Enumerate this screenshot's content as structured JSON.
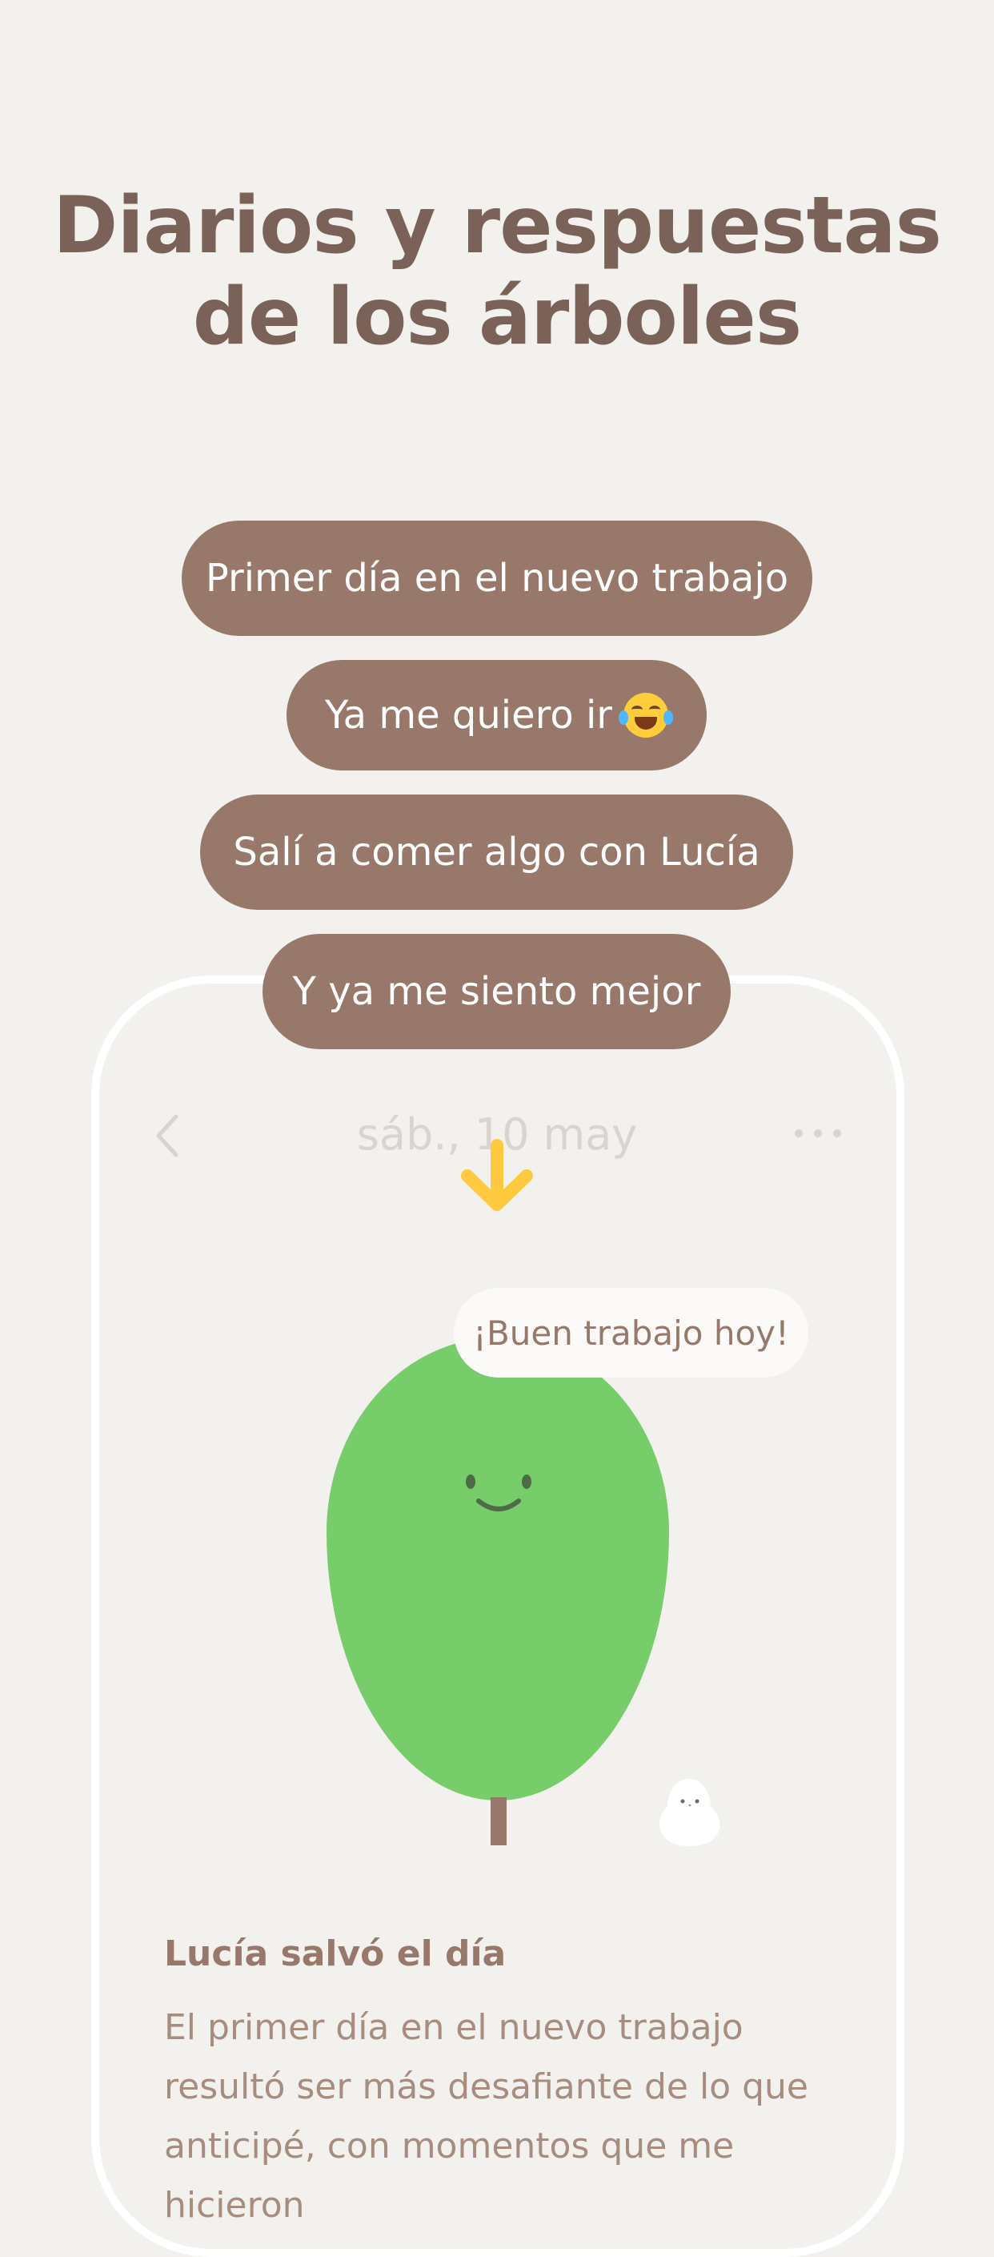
{
  "headline": {
    "line1": "Diarios y respuestas",
    "line2": "de los árboles"
  },
  "bubbles": [
    {
      "text": "Primer día en el nuevo trabajo"
    },
    {
      "text": "Ya me quiero ir",
      "emoji": "face-with-tears-of-joy"
    },
    {
      "text": "Salí a comer algo con Lucía"
    },
    {
      "text": "Y ya me siento mejor"
    }
  ],
  "entry_screen": {
    "date_title": "sáb., 10 may",
    "back_icon": "chevron-left-icon",
    "more_icon": "more-dots-icon",
    "tree_reply": "¡Buen trabajo hoy!",
    "entry_title": "Lucía salvó el día",
    "entry_body": "El primer día en el nuevo trabajo resultó ser más desafiante de lo que anticipé, con momentos que me hicieron"
  },
  "colors": {
    "background": "#f3f1ed",
    "headline": "#7a6259",
    "bubble": "#98786b",
    "tree": "#76cd69",
    "arrow": "#ffc940",
    "body_text": "#a78d80"
  }
}
